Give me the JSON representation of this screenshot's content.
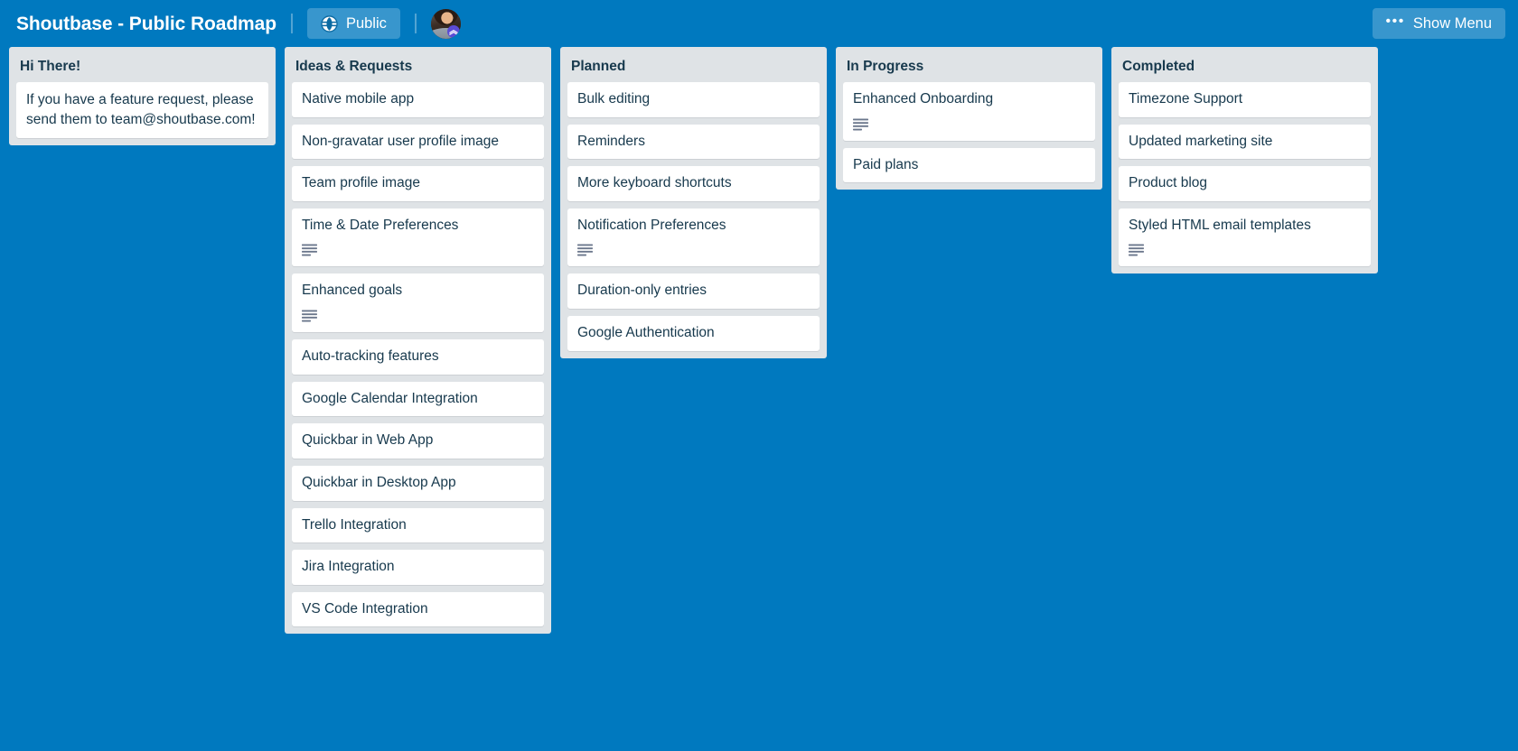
{
  "header": {
    "title": "Shoutbase - Public Roadmap",
    "visibility_label": "Public",
    "visibility_icon": "globe-icon",
    "avatar_icon": "user-avatar",
    "menu_label": "Show Menu",
    "menu_icon": "dots-horizontal-icon"
  },
  "colors": {
    "board_background": "#0079bf",
    "list_background": "#dfe3e6",
    "card_background": "#ffffff",
    "text_primary": "#17394d",
    "header_text": "#ffffff",
    "header_button": "rgba(255,255,255,0.22)"
  },
  "lists": [
    {
      "title": "Hi There!",
      "cards": [
        {
          "title": "If you have a feature request, please send them to team@shoutbase.com!",
          "has_description": false
        }
      ]
    },
    {
      "title": "Ideas & Requests",
      "cards": [
        {
          "title": "Native mobile app",
          "has_description": false
        },
        {
          "title": "Non-gravatar user profile image",
          "has_description": false
        },
        {
          "title": "Team profile image",
          "has_description": false
        },
        {
          "title": "Time & Date Preferences",
          "has_description": true
        },
        {
          "title": "Enhanced goals",
          "has_description": true
        },
        {
          "title": "Auto-tracking features",
          "has_description": false
        },
        {
          "title": "Google Calendar Integration",
          "has_description": false
        },
        {
          "title": "Quickbar in Web App",
          "has_description": false
        },
        {
          "title": "Quickbar in Desktop App",
          "has_description": false
        },
        {
          "title": "Trello Integration",
          "has_description": false
        },
        {
          "title": "Jira Integration",
          "has_description": false
        },
        {
          "title": "VS Code Integration",
          "has_description": false
        }
      ]
    },
    {
      "title": "Planned",
      "cards": [
        {
          "title": "Bulk editing",
          "has_description": false
        },
        {
          "title": "Reminders",
          "has_description": false
        },
        {
          "title": "More keyboard shortcuts",
          "has_description": false
        },
        {
          "title": "Notification Preferences",
          "has_description": true
        },
        {
          "title": "Duration-only entries",
          "has_description": false
        },
        {
          "title": "Google Authentication",
          "has_description": false
        }
      ]
    },
    {
      "title": "In Progress",
      "cards": [
        {
          "title": "Enhanced Onboarding",
          "has_description": true
        },
        {
          "title": "Paid plans",
          "has_description": false
        }
      ]
    },
    {
      "title": "Completed",
      "cards": [
        {
          "title": "Timezone Support",
          "has_description": false
        },
        {
          "title": "Updated marketing site",
          "has_description": false
        },
        {
          "title": "Product blog",
          "has_description": false
        },
        {
          "title": "Styled HTML email templates",
          "has_description": true
        }
      ]
    }
  ]
}
